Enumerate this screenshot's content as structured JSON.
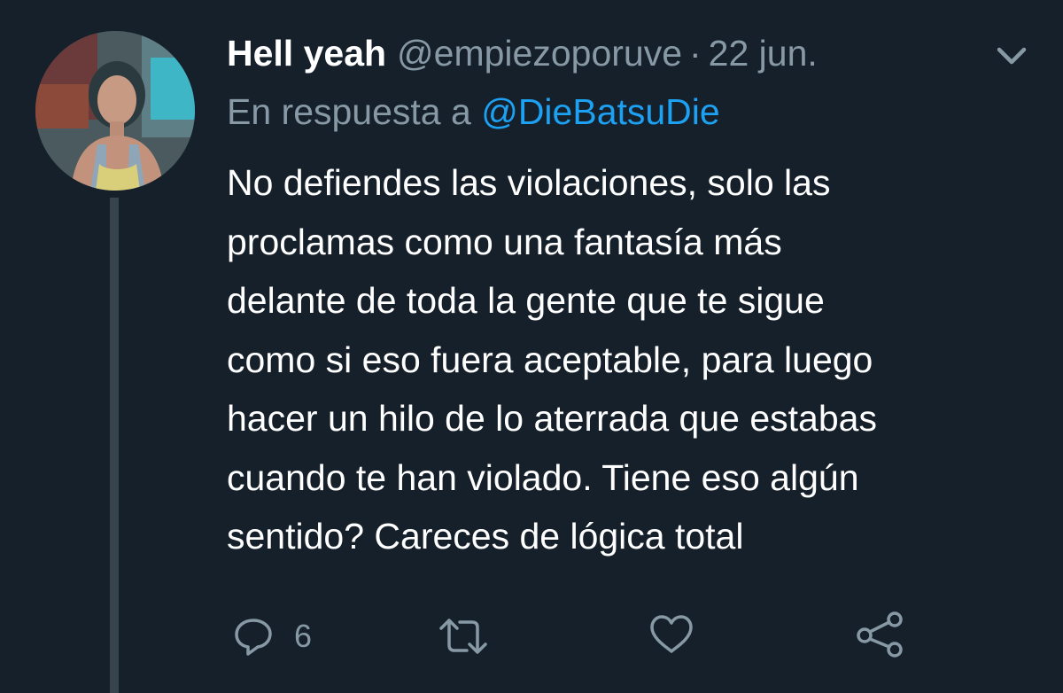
{
  "tweet": {
    "author_name": "Hell yeah",
    "author_handle": "@empiezoporuve",
    "separator": "·",
    "date": "22 jun.",
    "reply_prefix": "En respuesta a",
    "reply_mention": "@DieBatsuDie",
    "text_lines": [
      "No defiendes las violaciones, solo las",
      "proclamas como una fantasía más",
      "delante de toda la gente que te sigue",
      "como si eso fuera aceptable, para luego",
      "hacer un hilo de lo aterrada que estabas",
      "cuando te han violado. Tiene eso algún",
      "sentido? Careces de lógica total"
    ]
  },
  "actions": {
    "reply_count": "6",
    "icons": [
      "reply-icon",
      "retweet-icon",
      "like-icon",
      "share-icon"
    ]
  },
  "colors": {
    "background": "#15202b",
    "primary_text": "#ffffff",
    "secondary_text": "#8899a6",
    "link": "#1da1f2",
    "thread_line": "#38444d"
  }
}
